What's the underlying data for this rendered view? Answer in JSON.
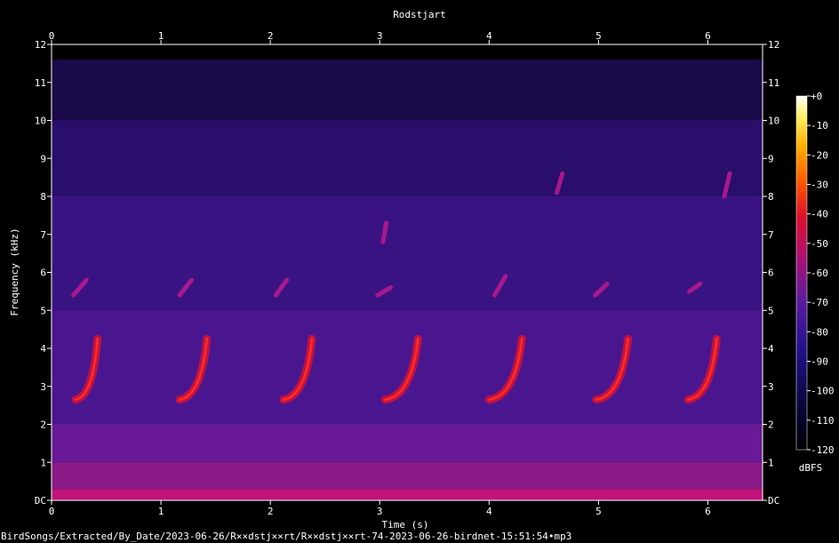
{
  "chart_data": {
    "type": "heatmap",
    "title": "Rodstjart",
    "xlabel": "Time (s)",
    "ylabel": "Frequency (kHz)",
    "xlim": [
      0,
      6.5
    ],
    "ylim": [
      0,
      12
    ],
    "x_ticks": [
      "0",
      "1",
      "2",
      "3",
      "4",
      "5",
      "6"
    ],
    "y_ticks": [
      "DC",
      "1",
      "2",
      "3",
      "4",
      "5",
      "6",
      "7",
      "8",
      "9",
      "10",
      "11",
      "12"
    ],
    "colorbar": {
      "label": "dBFS",
      "range": [
        -120,
        0
      ],
      "ticks": [
        "+0",
        "-10",
        "-20",
        "-30",
        "-40",
        "-50",
        "-60",
        "-70",
        "-80",
        "-90",
        "-100",
        "-110",
        "-120"
      ]
    },
    "colors": {
      "low": "#000000",
      "mid_low": "#1a0660",
      "mid": "#5a1ba0",
      "high": "#e0102a",
      "peak": "#ffffff"
    },
    "calls": [
      {
        "t_start": 0.22,
        "t_end": 0.42,
        "f_start": 2.65,
        "f_end": 4.25
      },
      {
        "t_start": 1.17,
        "t_end": 1.42,
        "f_start": 2.65,
        "f_end": 4.25
      },
      {
        "t_start": 2.12,
        "t_end": 2.38,
        "f_start": 2.65,
        "f_end": 4.25
      },
      {
        "t_start": 3.05,
        "t_end": 3.35,
        "f_start": 2.65,
        "f_end": 4.25
      },
      {
        "t_start": 4.0,
        "t_end": 4.3,
        "f_start": 2.65,
        "f_end": 4.25
      },
      {
        "t_start": 4.98,
        "t_end": 5.27,
        "f_start": 2.65,
        "f_end": 4.25
      },
      {
        "t_start": 5.82,
        "t_end": 6.08,
        "f_start": 2.65,
        "f_end": 4.25
      }
    ],
    "high_notes": [
      {
        "t_start": 0.2,
        "t_end": 0.32,
        "f_start": 5.4,
        "f_end": 5.8
      },
      {
        "t_start": 1.17,
        "t_end": 1.28,
        "f_start": 5.4,
        "f_end": 5.8
      },
      {
        "t_start": 2.05,
        "t_end": 2.15,
        "f_start": 5.4,
        "f_end": 5.8
      },
      {
        "t_start": 2.98,
        "t_end": 3.1,
        "f_start": 5.4,
        "f_end": 5.6
      },
      {
        "t_start": 4.05,
        "t_end": 4.15,
        "f_start": 5.4,
        "f_end": 5.9
      },
      {
        "t_start": 4.97,
        "t_end": 5.08,
        "f_start": 5.4,
        "f_end": 5.7
      },
      {
        "t_start": 5.83,
        "t_end": 5.93,
        "f_start": 5.5,
        "f_end": 5.7
      },
      {
        "t_start": 3.03,
        "t_end": 3.06,
        "f_start": 6.8,
        "f_end": 7.3
      },
      {
        "t_start": 4.62,
        "t_end": 4.67,
        "f_start": 8.1,
        "f_end": 8.6
      },
      {
        "t_start": 6.15,
        "t_end": 6.2,
        "f_start": 8.0,
        "f_end": 8.6
      }
    ],
    "grid": false
  },
  "footer": {
    "filepath": "BirdSongs/Extracted/By_Date/2023-06-26/R××dstj××rt/R××dstj××rt-74-2023-06-26-birdnet-15:51:54•mp3"
  }
}
